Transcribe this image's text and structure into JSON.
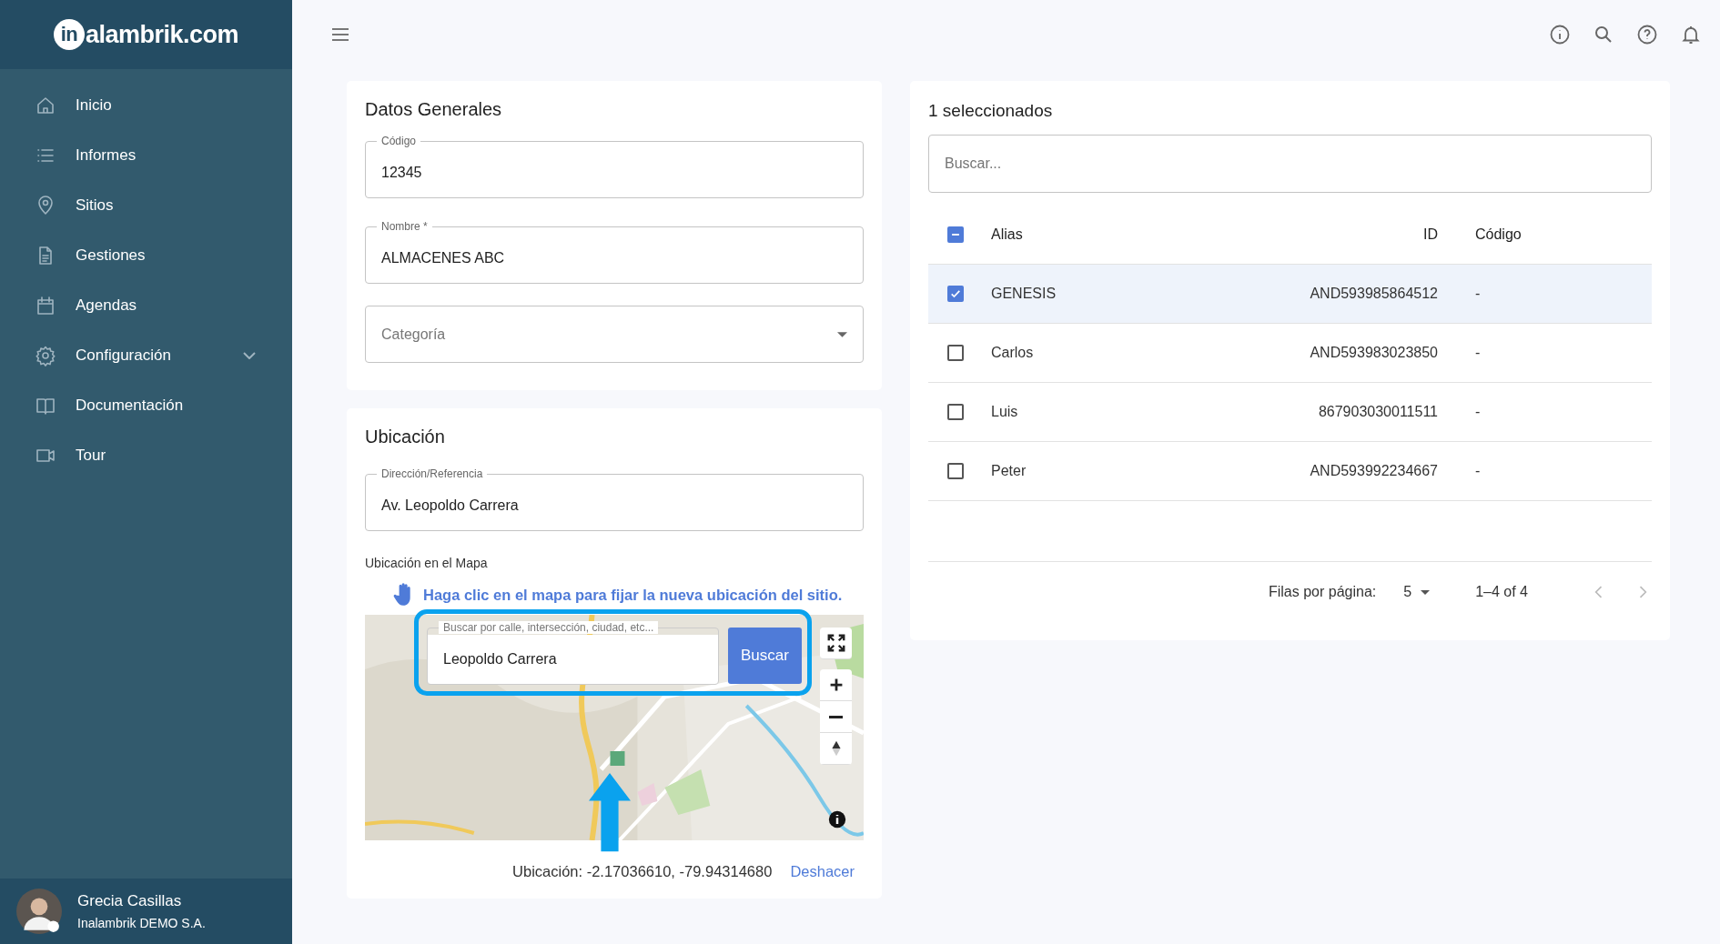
{
  "logo": {
    "mark": "in",
    "text": "alambrik.com"
  },
  "sidebar": {
    "items": [
      {
        "label": "Inicio"
      },
      {
        "label": "Informes"
      },
      {
        "label": "Sitios"
      },
      {
        "label": "Gestiones"
      },
      {
        "label": "Agendas"
      },
      {
        "label": "Configuración",
        "expanded": false
      },
      {
        "label": "Documentación"
      },
      {
        "label": "Tour"
      }
    ]
  },
  "user": {
    "name": "Grecia Casillas",
    "company": "Inalambrik DEMO S.A."
  },
  "datos_generales": {
    "title": "Datos Generales",
    "fields": [
      {
        "kind": "text",
        "label": "Código",
        "value": "12345"
      },
      {
        "kind": "text",
        "label": "Nombre *",
        "value": "ALMACENES ABC"
      },
      {
        "kind": "select",
        "placeholder": "Categoría"
      }
    ]
  },
  "ubicacion": {
    "title": "Ubicación",
    "field": {
      "label": "Dirección/Referencia",
      "value": "Av. Leopoldo Carrera"
    },
    "map_label": "Ubicación en el Mapa",
    "hint": "Haga clic en el mapa para fijar la nueva ubicación del sitio.",
    "map_search": {
      "label": "Buscar por calle, intersección, ciudad, etc...",
      "value": "Leopoldo Carrera",
      "button": "Buscar"
    },
    "location": "Ubicación: -2.17036610, -79.94314680",
    "undo": "Deshacer"
  },
  "table": {
    "title": "1 seleccionados",
    "search": {
      "placeholder": "Buscar..."
    },
    "header_indeterminate": true,
    "columns": [
      "Alias",
      "ID",
      "Código"
    ],
    "rows": [
      {
        "selected": true,
        "alias": "GENESIS",
        "id": "AND593985864512",
        "codigo": "-"
      },
      {
        "selected": false,
        "alias": "Carlos",
        "id": "AND593983023850",
        "codigo": "-"
      },
      {
        "selected": false,
        "alias": "Luis",
        "id": "867903030011511",
        "codigo": "-"
      },
      {
        "selected": false,
        "alias": "Peter",
        "id": "AND593992234667",
        "codigo": "-"
      }
    ],
    "pagination": {
      "label": "Filas por página:",
      "rows_per_page": "5",
      "range": "1–4 of 4"
    }
  }
}
